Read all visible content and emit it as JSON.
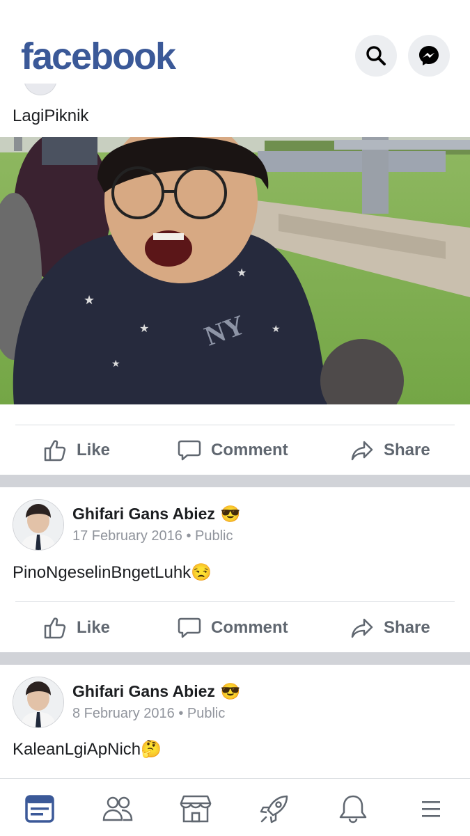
{
  "app": {
    "logo_text": "facebook",
    "brand_color": "#3b5998",
    "icons": [
      "search-icon",
      "messenger-icon"
    ]
  },
  "feed": {
    "first_post": {
      "text": "LagiPiknik",
      "actions": {
        "like": "Like",
        "comment": "Comment",
        "share": "Share"
      }
    },
    "posts": [
      {
        "author": "Ghifari Gans Abiez",
        "author_emoji": "😎",
        "date": "17 February 2016",
        "visibility": "Public",
        "text": "PinoNgeselinBngetLuhk",
        "text_emoji": "😒",
        "actions": {
          "like": "Like",
          "comment": "Comment",
          "share": "Share"
        }
      },
      {
        "author": "Ghifari Gans Abiez",
        "author_emoji": "😎",
        "date": "8 February 2016",
        "visibility": "Public",
        "text": "KaleanLgiApNich",
        "text_emoji": "🤔"
      }
    ]
  },
  "tabbar": {
    "tabs": [
      "news-feed-icon",
      "friends-icon",
      "marketplace-icon",
      "explore-icon",
      "notifications-icon",
      "menu-icon"
    ],
    "active": "news-feed-icon",
    "active_color": "#3b5998"
  }
}
